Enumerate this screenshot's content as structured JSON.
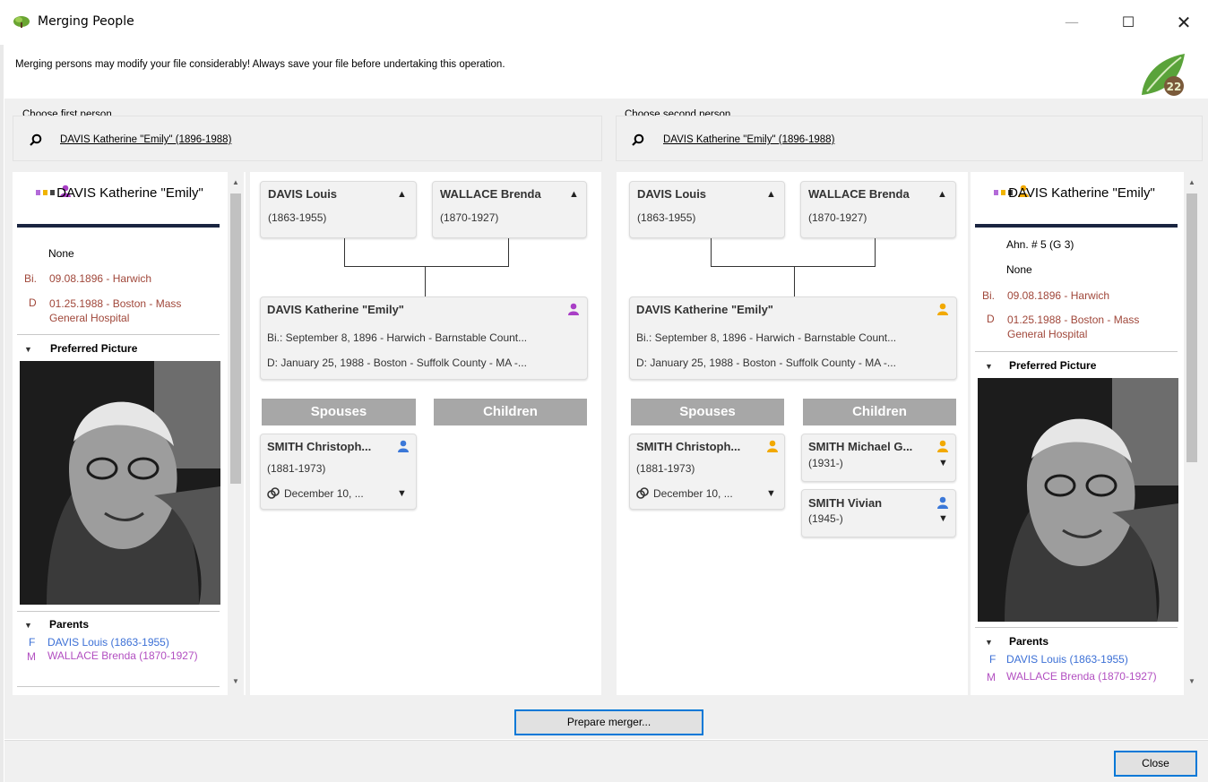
{
  "window": {
    "title": "Merging People",
    "minimize": "—",
    "maximize": "☐",
    "close": "✕"
  },
  "warning": "Merging persons may modify your file considerably! Always save your file before undertaking this operation.",
  "logo_text": "22",
  "first": {
    "label": "Choose first person",
    "search_value": "DAVIS Katherine \"Emily\" (1896-1988)"
  },
  "second": {
    "label": "Choose second person",
    "search_value": "DAVIS Katherine \"Emily\" (1896-1988)"
  },
  "left_panel": {
    "name": "DAVIS Katherine \"Emily\"",
    "none": "None",
    "birth_prefix": "Bi.",
    "birth": "09.08.1896 - Harwich",
    "death_prefix": "D",
    "death": "01.25.1988 - Boston - Mass General Hospital",
    "preferred_picture": "Preferred Picture",
    "parents_header": "Parents",
    "father_prefix": "F",
    "father": "DAVIS Louis (1863-1955)",
    "mother_prefix": "M",
    "mother": "WALLACE Brenda (1870-1927)"
  },
  "right_panel": {
    "name": "DAVIS Katherine \"Emily\"",
    "ahn": "Ahn. # 5 (G 3)",
    "none": "None",
    "birth_prefix": "Bi.",
    "birth": "09.08.1896 - Harwich",
    "death_prefix": "D",
    "death": "01.25.1988 - Boston - Mass General Hospital",
    "preferred_picture": "Preferred Picture",
    "parents_header": "Parents",
    "father_prefix": "F",
    "father": "DAVIS Louis (1863-1955)",
    "mother_prefix": "M",
    "mother": "WALLACE Brenda (1870-1927)"
  },
  "tree_left": {
    "father_name": "DAVIS Louis",
    "father_dates": "(1863-1955)",
    "mother_name": "WALLACE Brenda",
    "mother_dates": "(1870-1927)",
    "person_name": "DAVIS Katherine \"Emily\"",
    "person_birth": "Bi.: September 8, 1896 - Harwich - Barnstable Count...",
    "person_death": "D: January 25, 1988 - Boston - Suffolk County - MA -...",
    "spouses_header": "Spouses",
    "children_header": "Children",
    "spouse_name": "SMITH Christoph...",
    "spouse_dates": "(1881-1973)",
    "marriage": "December 10, ..."
  },
  "tree_right": {
    "father_name": "DAVIS Louis",
    "father_dates": "(1863-1955)",
    "mother_name": "WALLACE Brenda",
    "mother_dates": "(1870-1927)",
    "person_name": "DAVIS Katherine \"Emily\"",
    "person_birth": "Bi.: September 8, 1896 - Harwich - Barnstable Count...",
    "person_death": "D: January 25, 1988 - Boston - Suffolk County - MA -...",
    "spouses_header": "Spouses",
    "children_header": "Children",
    "spouse_name": "SMITH Christoph...",
    "spouse_dates": "(1881-1973)",
    "marriage": "December 10, ...",
    "child1_name": "SMITH Michael G...",
    "child1_dates": "(1931-)",
    "child2_name": "SMITH Vivian",
    "child2_dates": "(1945-)"
  },
  "buttons": {
    "prepare": "Prepare merger...",
    "close": "Close"
  },
  "colors": {
    "female": "#a93fc6",
    "female_alt": "#f2a900",
    "male": "#3b78d8",
    "accent": "#0078d7"
  }
}
